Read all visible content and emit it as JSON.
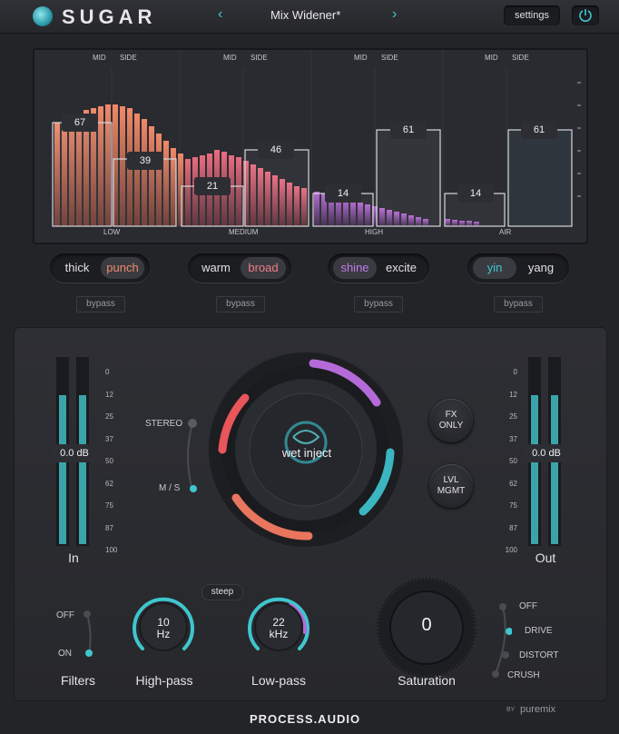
{
  "header": {
    "app_name": "SUGAR",
    "preset_name": "Mix Widener*",
    "prev_icon": "chevron-left-icon",
    "next_icon": "chevron-right-icon",
    "settings_label": "settings",
    "power_icon": "power-icon",
    "accent": "#3fc6cf"
  },
  "analyzer": {
    "mid_label": "MID",
    "side_label": "SIDE",
    "bands": [
      {
        "name": "LOW",
        "mid": "67",
        "side": "39"
      },
      {
        "name": "MEDIUM",
        "mid": "21",
        "side": "46"
      },
      {
        "name": "HIGH",
        "mid": "14",
        "side": "61"
      },
      {
        "name": "AIR",
        "mid": "14",
        "side": "61"
      }
    ]
  },
  "band_controls": [
    {
      "left": "thick",
      "right": "punch",
      "active": "right",
      "bypass": "bypass",
      "color": "#f08a6a"
    },
    {
      "left": "warm",
      "right": "broad",
      "active": "right",
      "bypass": "bypass",
      "color": "#f07a86"
    },
    {
      "left": "shine",
      "right": "excite",
      "active": "left",
      "bypass": "bypass",
      "color": "#c27ae8"
    },
    {
      "left": "yin",
      "right": "yang",
      "active": "left",
      "bypass": "bypass",
      "color": "#3fc6cf"
    }
  ],
  "meters": {
    "scale": [
      "0",
      "12",
      "25",
      "37",
      "50",
      "62",
      "75",
      "87",
      "100"
    ],
    "in_label": "In",
    "in_value": "0.0 dB",
    "out_label": "Out",
    "out_value": "0.0 dB"
  },
  "center": {
    "stereo_label": "STEREO",
    "ms_label": "M / S",
    "knob_label": "wet inject",
    "fx_only": [
      "FX",
      "ONLY"
    ],
    "lvl_mgmt": [
      "LVL",
      "MGMT"
    ]
  },
  "filters": {
    "off": "OFF",
    "on": "ON",
    "label": "Filters",
    "steep": "steep",
    "highpass": {
      "value": "10",
      "unit": "Hz",
      "label": "High-pass"
    },
    "lowpass": {
      "value": "22",
      "unit": "kHz",
      "label": "Low-pass"
    }
  },
  "saturation": {
    "value": "0",
    "label": "Saturation",
    "modes": [
      "OFF",
      "DRIVE",
      "DISTORT",
      "CRUSH"
    ],
    "selected": "DRIVE"
  },
  "footer": {
    "brand": "PROCESS.AUDIO",
    "by": "BY",
    "partner": "puremix"
  }
}
